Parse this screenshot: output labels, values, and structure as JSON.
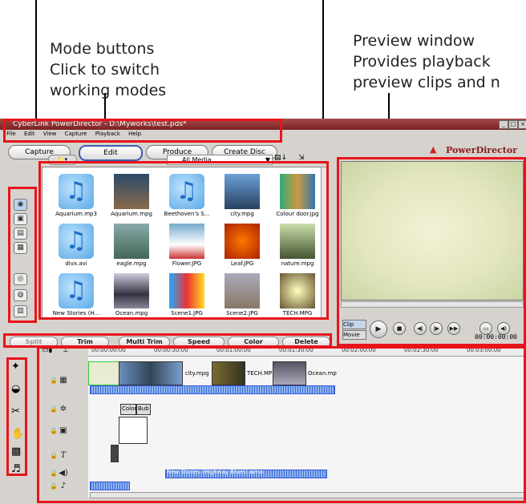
{
  "callouts": {
    "mode_title": "Mode buttons",
    "mode_line2": "Click to switch",
    "mode_line3": "working modes",
    "preview_title": "Preview window",
    "preview_line2": "Provides playback",
    "preview_line3": "preview clips and n"
  },
  "window": {
    "title": "CyberLink PowerDirector - D:\\Myworks\\test.pds*",
    "menu": [
      "File",
      "Edit",
      "View",
      "Capture",
      "Playback",
      "Help"
    ],
    "logo": "PowerDirector"
  },
  "mode_buttons": [
    "Capture",
    "Edit",
    "Produce",
    "Create Disc"
  ],
  "library": {
    "filter": "All Media",
    "items": [
      {
        "name": "Aquarium.mp3",
        "kind": "music-note-icon"
      },
      {
        "name": "Aquarium.mpg",
        "kind": "reef-thumbnail"
      },
      {
        "name": "Beethoven's S...",
        "kind": "music-note-icon"
      },
      {
        "name": "city.mpg",
        "kind": "city-thumbnail"
      },
      {
        "name": "Colour door.jpg",
        "kind": "door-thumbnail"
      },
      {
        "name": "divx.avi",
        "kind": "music-note-icon"
      },
      {
        "name": "eagle.mpg",
        "kind": "eagle-thumbnail"
      },
      {
        "name": "Flower.JPG",
        "kind": "flower-thumbnail"
      },
      {
        "name": "Leaf.JPG",
        "kind": "leaf-thumbnail"
      },
      {
        "name": "nature.mpg",
        "kind": "nature-thumbnail"
      },
      {
        "name": "New Stories (H...",
        "kind": "music-note-icon"
      },
      {
        "name": "Ocean.mpg",
        "kind": "ocean-thumbnail"
      },
      {
        "name": "Scene1.JPG",
        "kind": "scene1-thumbnail"
      },
      {
        "name": "Scene2.JPG",
        "kind": "scene2-thumbnail"
      },
      {
        "name": "TECH.MPG",
        "kind": "tech-thumbnail"
      }
    ]
  },
  "preview": {
    "clip_tab": "Clip",
    "movie_tab": "Movie",
    "timecode": "00:00:00:00"
  },
  "edit_buttons": [
    "Split",
    "Trim",
    "Multi Trim",
    "Speed",
    "Color",
    "Delete"
  ],
  "ruler": [
    "00:00:00:00",
    "00:00:30:00",
    "00:01:00:00",
    "00:01:30:00",
    "00:02:00:00",
    "00:02:30:00",
    "00:03:00:00"
  ],
  "timeline": {
    "clips": [
      "city.mpg",
      "TECH.MP",
      "Ocean.mp"
    ],
    "fx_clips": [
      "Color",
      "Bub"
    ],
    "audio_label": "New Stories (Highway Blues).wma"
  },
  "colors": {
    "callout_box": "#e8141b",
    "ui_gray": "#d6d3ce",
    "titlebar": "#7a2020"
  }
}
